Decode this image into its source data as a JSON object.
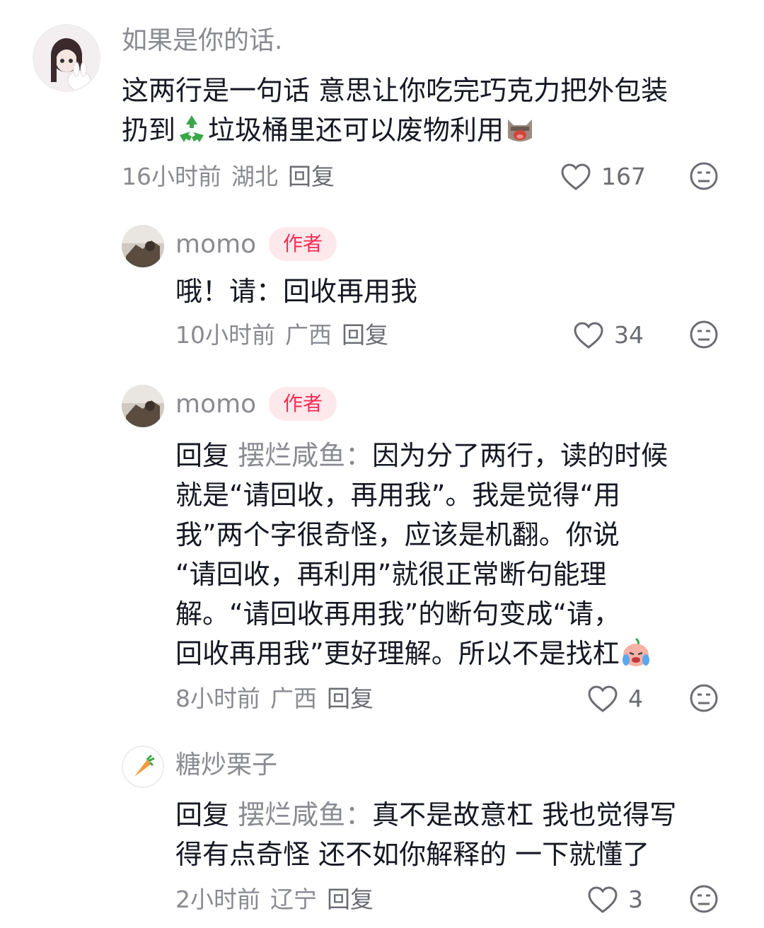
{
  "comments": [
    {
      "username": "如果是你的话.",
      "text_line1": "这两行是一句话 意思让你吃完巧克力把外包装",
      "text_line2_a": "扔到",
      "text_line2_b": "垃圾桶里还可以废物利用",
      "time": "16小时前",
      "location": "湖北",
      "reply_label": "回复",
      "likes": "167"
    },
    {
      "username": "momo",
      "badge": "作者",
      "text": "哦！请：回收再用我",
      "time": "10小时前",
      "location": "广西",
      "reply_label": "回复",
      "likes": "34"
    },
    {
      "username": "momo",
      "badge": "作者",
      "reply_prefix": "回复",
      "reply_target": "摆烂咸鱼：",
      "lines": [
        "因为分了两行，读的时候",
        "就是“请回收，再用我”。我是觉得“用",
        "我”两个字很奇怪，应该是机翻。你说",
        "“请回收，再利用”就很正常断句能理",
        "解。“请回收再用我”的断句变成“请，",
        "回收再用我”更好理解。所以不是找杠"
      ],
      "time": "8小时前",
      "location": "广西",
      "reply_label": "回复",
      "likes": "4"
    },
    {
      "username": "糖炒栗子",
      "reply_prefix": "回复",
      "reply_target": "摆烂咸鱼：",
      "lines": [
        "真不是故意杠 我也觉得写",
        "得有点奇怪 还不如你解释的 一下就懂了"
      ],
      "time": "2小时前",
      "location": "辽宁",
      "reply_label": "回复",
      "likes": "3"
    }
  ],
  "colors": {
    "text": "#161823",
    "secondary": "#8a8b91",
    "badge_bg": "#fde8ec",
    "badge_fg": "#fe2c55"
  }
}
